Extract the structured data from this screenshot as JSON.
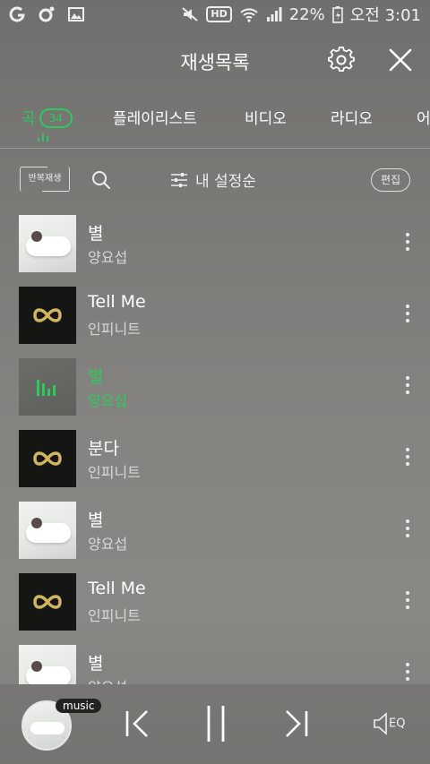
{
  "status_bar": {
    "battery": "22%",
    "time": "오전 3:01",
    "icons": [
      "notification-g-icon",
      "notification-dot-icon",
      "image-icon",
      "mute-icon",
      "hd-icon",
      "wifi-icon",
      "signal-icon",
      "battery-icon"
    ],
    "hd_label": "HD"
  },
  "header": {
    "title": "재생목록",
    "settings_icon": "gear-icon",
    "close_icon": "close-icon"
  },
  "tabs": [
    {
      "label": "곡",
      "count": "34",
      "active": true
    },
    {
      "label": "플레이리스트",
      "active": false
    },
    {
      "label": "비디오",
      "active": false
    },
    {
      "label": "라디오",
      "active": false
    },
    {
      "label": "어",
      "active": false
    }
  ],
  "toolbar": {
    "repeat_label": "반복재생",
    "sort_label": "내 설정순",
    "edit_label": "편집",
    "search_icon": "search-icon",
    "sort_icon": "sliders-icon"
  },
  "songs": [
    {
      "title": "별",
      "artist": "양요섭",
      "cover": "white",
      "playing": false
    },
    {
      "title": "Tell Me",
      "artist": "인피니트",
      "cover": "infinity",
      "playing": false
    },
    {
      "title": "별",
      "artist": "양요섭",
      "cover": "dim",
      "playing": true
    },
    {
      "title": "분다",
      "artist": "인피니트",
      "cover": "infinity",
      "playing": false
    },
    {
      "title": "별",
      "artist": "양요섭",
      "cover": "white",
      "playing": false
    },
    {
      "title": "Tell Me",
      "artist": "인피니트",
      "cover": "infinity",
      "playing": false
    },
    {
      "title": "별",
      "artist": "양요섭",
      "cover": "white",
      "playing": false
    }
  ],
  "player": {
    "badge": "music",
    "eq_label": "EQ",
    "icons": [
      "previous-icon",
      "pause-icon",
      "next-icon",
      "eq-icon"
    ]
  },
  "colors": {
    "accent": "#2ec95c",
    "background": "#7a7976"
  }
}
